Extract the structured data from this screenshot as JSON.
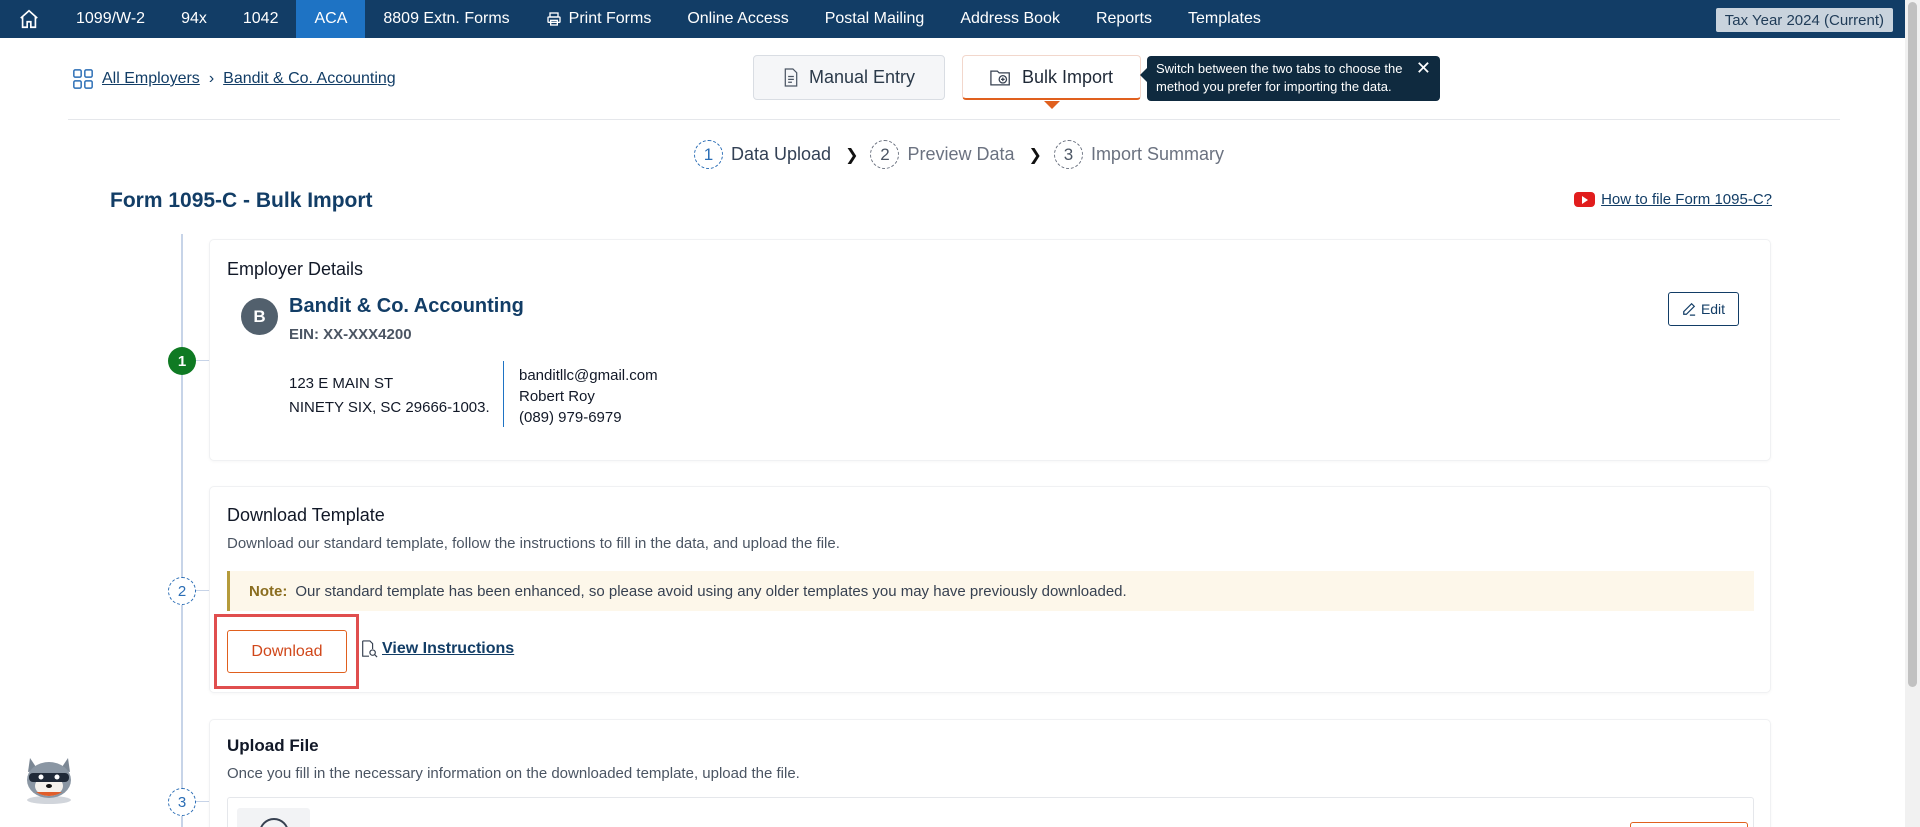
{
  "topnav": {
    "items": [
      {
        "label": "1099/W-2"
      },
      {
        "label": "94x"
      },
      {
        "label": "1042"
      },
      {
        "label": "ACA"
      },
      {
        "label": "8809 Extn. Forms"
      },
      {
        "label": "Print Forms"
      },
      {
        "label": "Online Access"
      },
      {
        "label": "Postal Mailing"
      },
      {
        "label": "Address Book"
      },
      {
        "label": "Reports"
      },
      {
        "label": "Templates"
      }
    ],
    "active": "ACA",
    "tax_year": "Tax Year 2024 (Current)"
  },
  "breadcrumb": {
    "all_employers": "All Employers",
    "employer": "Bandit & Co. Accounting"
  },
  "tabs": {
    "manual": "Manual Entry",
    "bulk": "Bulk Import"
  },
  "tooltip": {
    "text": "Switch between the two tabs to choose the method you prefer for importing the data.",
    "close": "✕"
  },
  "stepper": {
    "steps": [
      {
        "num": "1",
        "label": "Data Upload"
      },
      {
        "num": "2",
        "label": "Preview Data"
      },
      {
        "num": "3",
        "label": "Import Summary"
      }
    ]
  },
  "page": {
    "title": "Form 1095-C - Bulk Import",
    "howto": "How to file Form 1095-C?"
  },
  "timeline": [
    "1",
    "2",
    "3"
  ],
  "employer": {
    "section_title": "Employer Details",
    "initial": "B",
    "name": "Bandit & Co. Accounting",
    "ein": "EIN: XX-XXX4200",
    "address_line1": "123 E MAIN ST",
    "address_line2": "NINETY SIX, SC 29666-1003.",
    "email": "banditllc@gmail.com",
    "contact_name": "Robert Roy",
    "phone": "(089) 979-6979",
    "edit": "Edit"
  },
  "download": {
    "title": "Download Template",
    "subtitle": "Download our standard template, follow the instructions to fill in the data, and upload the file.",
    "note_label": "Note:",
    "note_text": "Our standard template has been enhanced, so please avoid using any older templates you may have previously downloaded.",
    "button": "Download",
    "view_instructions": "View Instructions"
  },
  "upload": {
    "title": "Upload File",
    "subtitle": "Once you fill in the necessary information on the downloaded template, upload the file."
  }
}
